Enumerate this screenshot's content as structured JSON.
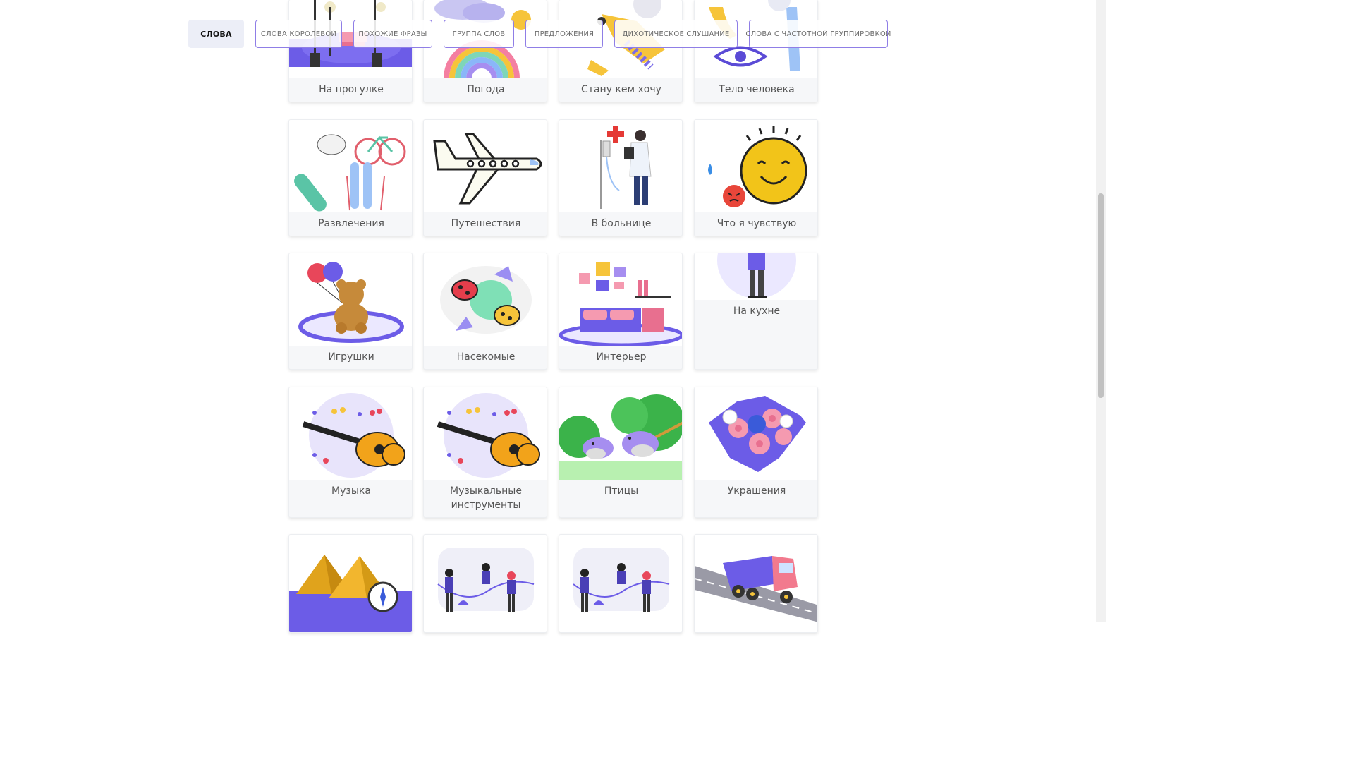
{
  "tabs": [
    {
      "label": "СЛОВА",
      "active": true
    },
    {
      "label": "СЛОВА КОРОЛЁВОЙ",
      "active": false
    },
    {
      "label": "ПОХОЖИЕ ФРАЗЫ",
      "active": false
    },
    {
      "label": "ГРУППА СЛОВ",
      "active": false
    },
    {
      "label": "ПРЕДЛОЖЕНИЯ",
      "active": false
    },
    {
      "label": "ДИХОТИЧЕСКОЕ СЛУШАНИЕ",
      "active": false
    },
    {
      "label": "СЛОВА С ЧАСТОТНОЙ ГРУППИРОВКОЙ",
      "active": false
    }
  ],
  "categories": [
    {
      "label": "На прогулке",
      "icon": "park-walk-illustration"
    },
    {
      "label": "Погода",
      "icon": "rainbow-weather-illustration"
    },
    {
      "label": "Стану кем хочу",
      "icon": "astronaut-illustration"
    },
    {
      "label": "Тело человека",
      "icon": "human-body-illustration"
    },
    {
      "label": "Развлечения",
      "icon": "sports-equipment-illustration"
    },
    {
      "label": "Путешествия",
      "icon": "airplane-illustration"
    },
    {
      "label": "В больнице",
      "icon": "doctor-illustration"
    },
    {
      "label": "Что я чувствую",
      "icon": "smiling-sun-illustration"
    },
    {
      "label": "Игрушки",
      "icon": "teddy-bear-illustration"
    },
    {
      "label": "Насекомые",
      "icon": "ladybugs-illustration"
    },
    {
      "label": "Интерьер",
      "icon": "bedroom-illustration"
    },
    {
      "label": "На кухне",
      "icon": "person-standing-illustration"
    },
    {
      "label": "Музыка",
      "icon": "guitar-illustration"
    },
    {
      "label": "Музыкальные инструменты",
      "icon": "guitar-illustration"
    },
    {
      "label": "Птицы",
      "icon": "birds-illustration"
    },
    {
      "label": "Украшения",
      "icon": "flowers-illustration"
    },
    {
      "label": "",
      "icon": "pyramids-illustration"
    },
    {
      "label": "",
      "icon": "people-talking-illustration"
    },
    {
      "label": "",
      "icon": "people-talking-illustration"
    },
    {
      "label": "",
      "icon": "truck-illustration"
    }
  ]
}
